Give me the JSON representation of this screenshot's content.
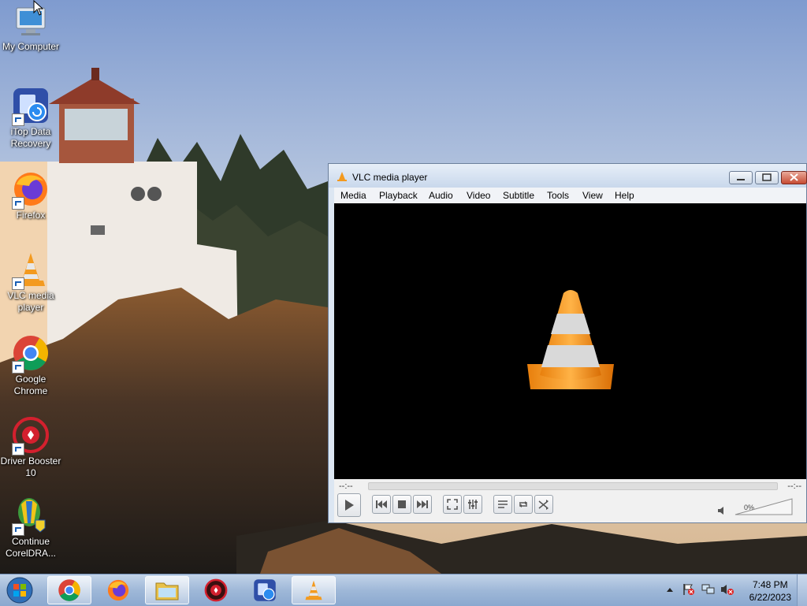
{
  "desktop": {
    "icons": [
      {
        "label_line1": "My Computer",
        "label_line2": "",
        "icon": "computer-icon"
      },
      {
        "label_line1": "iTop Data",
        "label_line2": "Recovery",
        "icon": "itop-data-recovery-icon"
      },
      {
        "label_line1": "Firefox",
        "label_line2": "",
        "icon": "firefox-icon"
      },
      {
        "label_line1": "VLC media",
        "label_line2": "player",
        "icon": "vlc-icon"
      },
      {
        "label_line1": "Google",
        "label_line2": "Chrome",
        "icon": "chrome-icon"
      },
      {
        "label_line1": "Driver Booster",
        "label_line2": "10",
        "icon": "driver-booster-icon"
      },
      {
        "label_line1": "Continue",
        "label_line2": "CorelDRA...",
        "icon": "coreldraw-icon"
      }
    ]
  },
  "vlc": {
    "title": "VLC media player",
    "menu": [
      "Media",
      "Playback",
      "Audio",
      "Video",
      "Subtitle",
      "Tools",
      "View",
      "Help"
    ],
    "time_elapsed": "--:--",
    "time_total": "--:--",
    "volume_label": "0%",
    "volume_level": 0
  },
  "taskbar": {
    "apps": [
      "start-orb-icon",
      "chrome-icon",
      "firefox-icon",
      "file-explorer-icon",
      "driver-booster-icon",
      "itop-data-recovery-icon",
      "vlc-icon"
    ],
    "active_app": "vlc-icon",
    "time": "7:48 PM",
    "date": "6/22/2023"
  },
  "colors": {
    "vlc_orange": "#f39a1f",
    "taskbar": "#9fb8d8",
    "close_red": "#c74b33"
  }
}
